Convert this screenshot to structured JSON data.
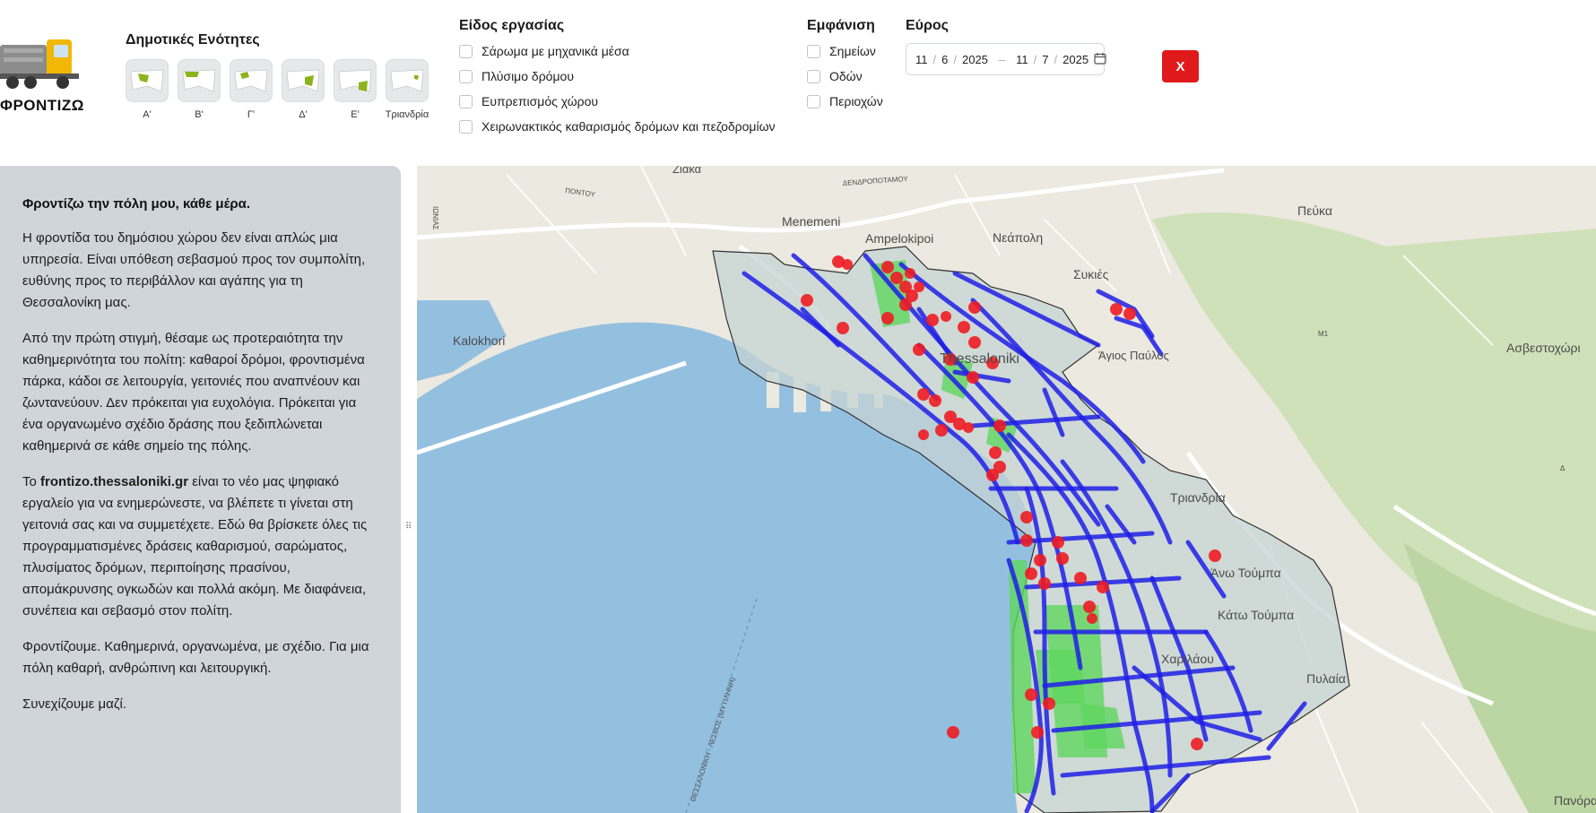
{
  "logo": {
    "brand": "ΦΡΟΝΤΙΖΩ"
  },
  "units": {
    "title": "Δημοτικές Ενότητες",
    "items": [
      {
        "label": "Α'"
      },
      {
        "label": "Β'"
      },
      {
        "label": "Γ'"
      },
      {
        "label": "Δ'"
      },
      {
        "label": "Ε'"
      },
      {
        "label": "Τριανδρία"
      }
    ]
  },
  "work_type": {
    "title": "Είδος εργασίας",
    "options": [
      "Σάρωμα με μηχανικά μέσα",
      "Πλύσιμο δρόμου",
      "Ευπρεπισμός χώρου",
      "Χειρωνακτικός καθαρισμός δρόμων και πεζοδρομίων"
    ]
  },
  "display": {
    "title": "Εμφάνιση",
    "options": [
      "Σημείων",
      "Οδών",
      "Περιοχών"
    ]
  },
  "range": {
    "title": "Εύρος",
    "from_day": "11",
    "from_month": "6",
    "from_year": "2025",
    "to_day": "11",
    "to_month": "7",
    "to_year": "2025"
  },
  "clear_button": "X",
  "panel": {
    "heading": "Φροντίζω την πόλη μου, κάθε μέρα.",
    "p1": "Η φροντίδα του δημόσιου χώρου δεν είναι απλώς μια υπηρεσία. Είναι υπόθεση σεβασμού προς τον συμπολίτη, ευθύνης προς το περιβάλλον και αγάπης για τη Θεσσαλονίκη μας.",
    "p2": "Από την πρώτη στιγμή, θέσαμε ως προτεραιότητα την καθημερινότητα του πολίτη: καθαροί δρόμοι, φροντισμένα πάρκα, κάδοι σε λειτουργία, γειτονιές που αναπνέουν και ζωντανεύουν. Δεν πρόκειται για ευχολόγια. Πρόκειται για ένα οργανωμένο σχέδιο δράσης που ξεδιπλώνεται καθημερινά σε κάθε σημείο της πόλης.",
    "p3_prefix": "Το ",
    "p3_link": "frontizo.thessaloniki.gr",
    "p3_rest": " είναι το νέο μας ψηφιακό εργαλείο για να ενημερώνεστε, να βλέπετε τι γίνεται στη γειτονιά σας και να συμμετέχετε. Εδώ θα βρίσκετε όλες τις προγραμματισμένες δράσεις καθαρισμού, σαρώματος, πλυσίματος δρόμων, περιποίησης πρασίνου, απομάκρυνσης ογκωδών και πολλά ακόμη. Με διαφάνεια, συνέπεια και σεβασμό στον πολίτη.",
    "p4": "Φροντίζουμε. Καθημερινά, οργανωμένα, με σχέδιο. Για μια πόλη καθαρή, ανθρώπινη και λειτουργική.",
    "p5": "Συνεχίζουμε μαζί."
  },
  "map": {
    "labels": {
      "ziaka": "Ζιάκα",
      "pontou": "ΠΟΝΤΟΥ",
      "dendropotamou": "ΔΕΝΔΡΟΠΟΤΑΜΟΥ",
      "menemeni": "Menemeni",
      "ampelokipoi": "Ampelokipoi",
      "neapoli": "Νεάπολη",
      "sykies": "Συκιές",
      "peuka": "Πεύκα",
      "kalokhori": "Kalokhori",
      "thessaloniki": "Thessaloniki",
      "agios_pavlos": "Άγιος Παύλος",
      "asvestochori": "Ασβεστοχώρι",
      "triandria": "Τριανδρία",
      "ano_toumpa": "Άνω Τούμπα",
      "kato_toumpa": "Κάτω Τούμπα",
      "charilaou": "Χαριλάου",
      "pylaia": "Πυλαία",
      "panorama": "Πανόρα",
      "ferry": "ΘΕΣΣΑΛΟΝΙΚΗ - ΛΕΣΒΟΣ (ΜΥΤΙΛΗΝΗ)",
      "m1": "Μ1",
      "d": "Δ",
      "ionias": "ΙΩΝΙΑΣ"
    },
    "colors": {
      "water": "#94c0e0",
      "land": "#ece9e0",
      "area": "#c5d3d3",
      "street": "#1f1fe6",
      "point": "#ee1c24",
      "park": "#6fd66f",
      "forest": "#b9d8a0"
    }
  }
}
